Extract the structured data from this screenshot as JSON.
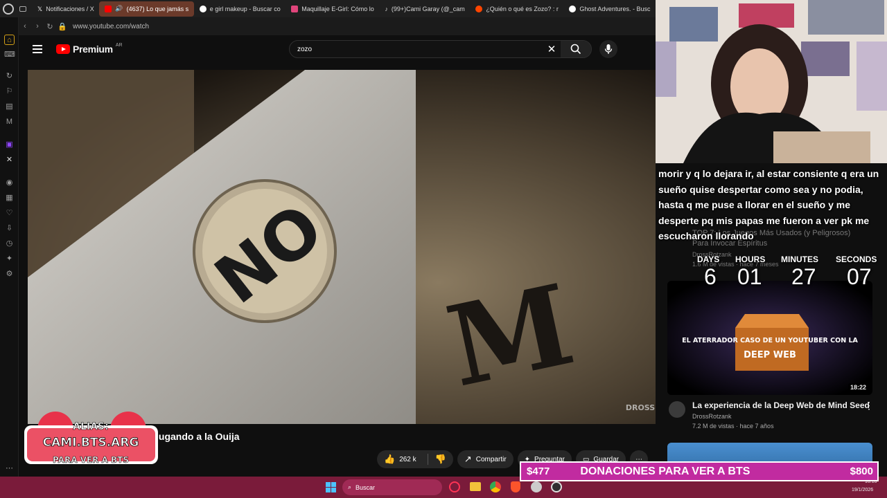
{
  "tabs": [
    {
      "label": "Notificaciones / X",
      "color": "#ffffff"
    },
    {
      "label": "(4637) Lo que jamás s",
      "color": "#ff0000"
    },
    {
      "label": "e girl makeup - Buscar co",
      "color": "#4285f4"
    },
    {
      "label": "Maquillaje E-Girl: Cómo lo",
      "color": "#e0457b"
    },
    {
      "label": "(99+)Cami Garay (@_cam",
      "color": "#ffffff"
    },
    {
      "label": "¿Quién o qué es Zozo? : r",
      "color": "#ff4500"
    },
    {
      "label": "Ghost Adventures. - Busc",
      "color": "#4285f4"
    }
  ],
  "browser": {
    "url": "www.youtube.com/watch"
  },
  "youtube": {
    "brand": "Premium",
    "country": "AR",
    "search_value": "zozo",
    "video_title": "jugando a la Ouija",
    "likes": "262 k",
    "share_label": "Compartir",
    "ask_label": "Preguntar",
    "save_label": "Guardar",
    "watermark": "DROSS"
  },
  "player_text": {
    "no": "NO",
    "m": "M"
  },
  "chat_message": "morir y q lo dejara ir, al estar consiente q era un sueño quise despertar como sea y no podia, hasta q me puse a llorar en el sueño y me desperte pq mis papas me fueron a ver pk me escucharon llorando",
  "countdown": {
    "labels": [
      "DAYS",
      "HOURS",
      "MINUTES",
      "SECONDS"
    ],
    "values": [
      "6",
      "01",
      "27",
      "07"
    ]
  },
  "related": [
    {
      "title": "TOP 7: Los Juegos Más Usados (y Peligrosos) Para Invocar Espíritus",
      "channel": "DrossRotzank",
      "meta": "1.6 M de vistas · hace 7 meses"
    },
    {
      "thumb_text": "EL ATERRADOR CASO DE UN YOUTUBER CON LA",
      "thumb_box": "DEEP WEB",
      "duration": "18:22",
      "title": "La experiencia de la Deep Web de Mind Seed",
      "channel": "DrossRotzank",
      "meta": "7.2 M de vistas · hace 7 años"
    }
  ],
  "donation": {
    "current": "$477",
    "label": "DONACIONES PARA VER A BTS",
    "goal": "$800"
  },
  "overlay_logo": {
    "alias": "ALIAS:",
    "handle": "CAMI.BTS.ARG",
    "sub": "PARA VER A BTS"
  },
  "taskbar": {
    "search_label": "Buscar",
    "time": "16:16",
    "date": "19/1/2026"
  }
}
